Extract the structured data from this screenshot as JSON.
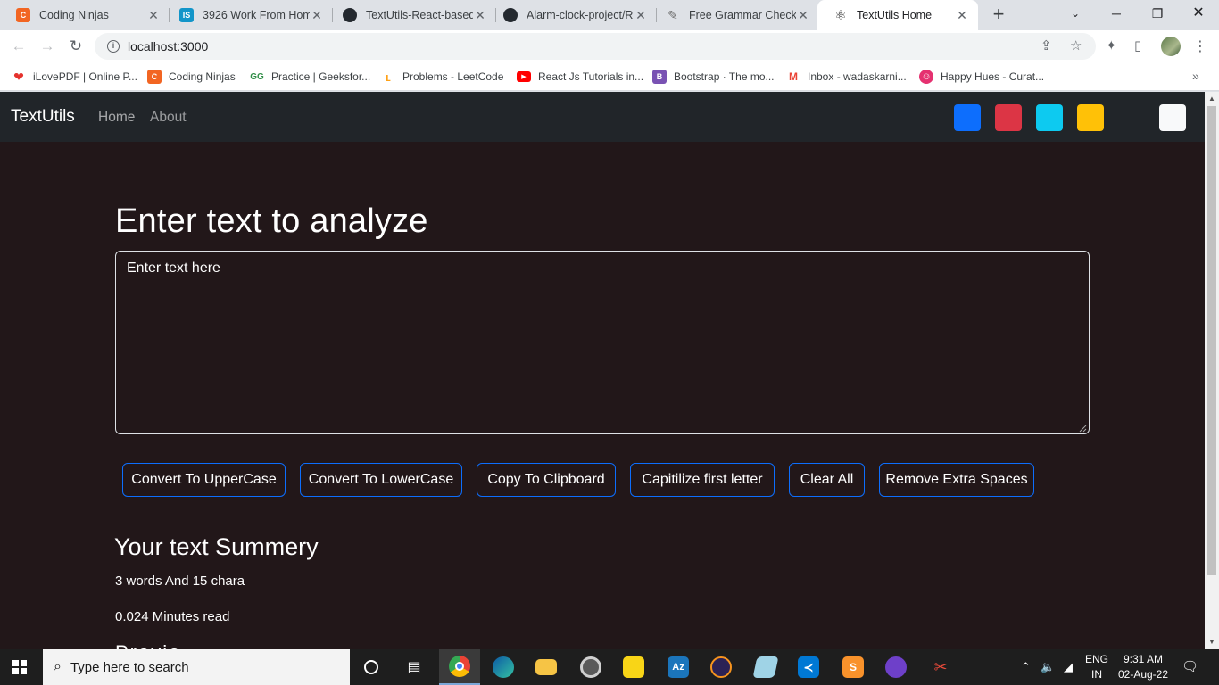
{
  "browser": {
    "tabs": [
      {
        "title": "Coding Ninjas",
        "icon": "coding-ninjas-icon",
        "color": "#f26522",
        "glyph": "C"
      },
      {
        "title": "3926 Work From Hom",
        "icon": "internshala-icon",
        "color": "#1295c9",
        "glyph": "IS"
      },
      {
        "title": "TextUtils-React-based",
        "icon": "github-icon",
        "color": "#24292f",
        "glyph": "⬤"
      },
      {
        "title": "Alarm-clock-project/R",
        "icon": "github-icon",
        "color": "#24292f",
        "glyph": "⬤"
      },
      {
        "title": "Free Grammar Checke",
        "icon": "quill-icon",
        "color": "#6b6b6b",
        "glyph": "✎"
      },
      {
        "title": "TextUtils Home",
        "icon": "react-icon",
        "color": "#222222",
        "glyph": "⚛"
      }
    ],
    "address": "localhost:3000",
    "bookmarks": [
      {
        "label": "iLovePDF | Online P...",
        "icon": "heart-icon",
        "color": "#e5322d",
        "glyph": "❤"
      },
      {
        "label": "Coding Ninjas",
        "icon": "coding-ninjas-icon",
        "color": "#f26522",
        "glyph": "C"
      },
      {
        "label": "Practice | Geeksfor...",
        "icon": "geeksforgeeks-icon",
        "color": "#2f8d46",
        "glyph": "GG"
      },
      {
        "label": "Problems - LeetCode",
        "icon": "leetcode-icon",
        "color": "#ffa116",
        "glyph": "L"
      },
      {
        "label": "React Js Tutorials in...",
        "icon": "youtube-icon",
        "color": "#ff0000",
        "glyph": "▶"
      },
      {
        "label": "Bootstrap · The mo...",
        "icon": "bootstrap-icon",
        "color": "#7952b3",
        "glyph": "B"
      },
      {
        "label": "Inbox - wadaskarni...",
        "icon": "gmail-icon",
        "color": "#ea4335",
        "glyph": "M"
      },
      {
        "label": "Happy Hues - Curat...",
        "icon": "happy-hues-icon",
        "color": "#e53170",
        "glyph": "☺"
      }
    ]
  },
  "app": {
    "brand": "TextUtils",
    "nav": [
      "Home",
      "About"
    ],
    "theme_swatches": [
      "#0d6efd",
      "#dc3545",
      "#0dcaf0",
      "#ffc107",
      "#f8f9fa"
    ],
    "heading": "Enter text to analyze",
    "textarea_placeholder": "Enter text here",
    "buttons": [
      "Convert To UpperCase",
      "Convert To LowerCase",
      "Copy To Clipboard",
      "Capitilize first letter",
      "Clear All",
      "Remove Extra Spaces"
    ],
    "summary_heading": "Your text Summery",
    "word_count": "3 words And 15 chara",
    "read_time": "0.024 Minutes read",
    "preview_heading": "Preview"
  },
  "taskbar": {
    "search_placeholder": "Type here to search",
    "lang": "ENG",
    "region": "IN",
    "time": "9:31 AM",
    "date": "02-Aug-22"
  }
}
